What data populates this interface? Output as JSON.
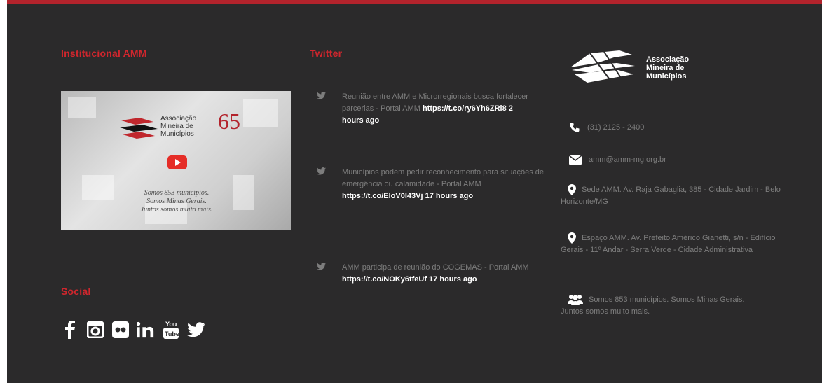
{
  "institucional": {
    "heading": "Institucional AMM",
    "video": {
      "brand_lines": [
        "Associação",
        "Mineira de",
        "Municípios"
      ],
      "anniversary": "65",
      "caption_lines": [
        "Somos 853 municípios.",
        "Somos Minas Gerais.",
        "Juntos somos muito mais."
      ]
    }
  },
  "social": {
    "heading": "Social",
    "icons": [
      "facebook-icon",
      "instagram-icon",
      "flickr-icon",
      "linkedin-icon",
      "youtube-icon",
      "twitter-icon"
    ]
  },
  "twitter": {
    "heading": "Twitter",
    "tweets": [
      {
        "text": "Reunião entre AMM e Microrregionais busca fortalecer parcerias - Portal AMM",
        "link": "https://t.co/ry6Yh6ZRi8",
        "time": "2 hours ago"
      },
      {
        "text": "Municípios podem pedir reconhecimento para situações de emergência ou calamidade - Portal AMM",
        "link": "https://t.co/EIoV0I43Vj",
        "time": "17 hours ago"
      },
      {
        "text": "AMM participa de reunião do COGEMAS - Portal AMM",
        "link": "https://t.co/NOKy6tfeUf",
        "time": "17 hours ago"
      }
    ]
  },
  "contact": {
    "brand_lines": [
      "Associação",
      "Mineira de",
      "Municípios"
    ],
    "phone": "(31) 2125 - 2400",
    "email": "amm@amm-mg.org.br",
    "address_1": "Sede AMM. Av. Raja Gabaglia, 385 - Cidade Jardim - Belo Horizonte/MG",
    "address_2": "Espaço AMM. Av. Prefeito Américo Gianetti, s/n - Edifício Gerais - 11º Andar - Serra Verde - Cidade Administrativa",
    "members": "Somos 853 municípios. Somos Minas Gerais. Juntos somos muito mais."
  },
  "colors": {
    "background": "#2b2a2b",
    "accent": "#d0262d",
    "top_border": "#b3232c",
    "muted_text": "#7d7d7d"
  }
}
